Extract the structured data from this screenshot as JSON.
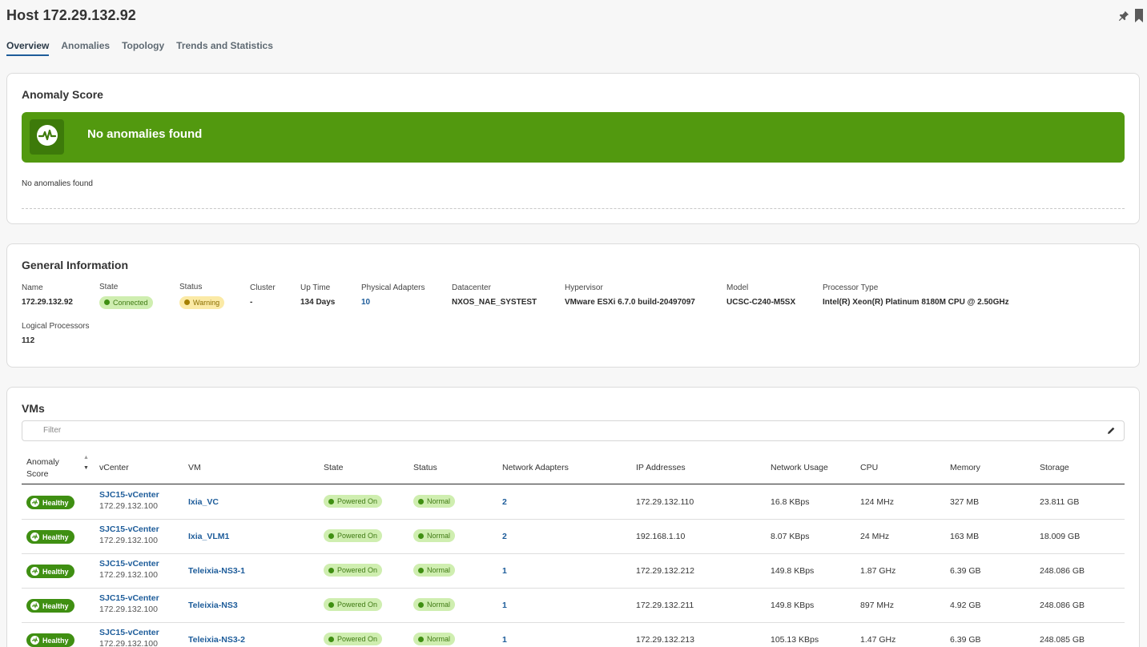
{
  "header": {
    "title": "Host 172.29.132.92"
  },
  "tabs": [
    {
      "label": "Overview",
      "active": true
    },
    {
      "label": "Anomalies"
    },
    {
      "label": "Topology"
    },
    {
      "label": "Trends and Statistics"
    }
  ],
  "anomaly": {
    "title": "Anomaly Score",
    "banner_text": "No anomalies found",
    "note": "No anomalies found",
    "color": "#52990f"
  },
  "general": {
    "title": "General Information",
    "name_label": "Name",
    "name": "172.29.132.92",
    "state_label": "State",
    "state": "Connected",
    "status_label": "Status",
    "status": "Warning",
    "cluster_label": "Cluster",
    "cluster": "-",
    "uptime_label": "Up Time",
    "uptime": "134 Days",
    "adapters_label": "Physical Adapters",
    "adapters": "10",
    "datacenter_label": "Datacenter",
    "datacenter": "NXOS_NAE_SYSTEST",
    "hypervisor_label": "Hypervisor",
    "hypervisor": "VMware ESXi 6.7.0 build-20497097",
    "model_label": "Model",
    "model": "UCSC-C240-M5SX",
    "processor_label": "Processor Type",
    "processor": "Intel(R) Xeon(R) Platinum 8180M CPU @ 2.50GHz",
    "logical_label": "Logical Processors",
    "logical": "112"
  },
  "vms": {
    "title": "VMs",
    "filter_placeholder": "Filter",
    "columns": {
      "anomaly_line1": "Anomaly",
      "anomaly_line2": "Score",
      "vcenter": "vCenter",
      "vm": "VM",
      "state": "State",
      "status": "Status",
      "adapters": "Network Adapters",
      "ip": "IP Addresses",
      "usage": "Network Usage",
      "cpu": "CPU",
      "memory": "Memory",
      "storage": "Storage"
    },
    "rows": [
      {
        "score": "Healthy",
        "vcenter": "SJC15-vCenter",
        "vcenter_ip": "172.29.132.100",
        "vm": "Ixia_VC",
        "state": "Powered On",
        "status": "Normal",
        "adapters": "2",
        "ip": "172.29.132.110",
        "usage": "16.8 KBps",
        "cpu": "124 MHz",
        "memory": "327 MB",
        "storage": "23.811 GB"
      },
      {
        "score": "Healthy",
        "vcenter": "SJC15-vCenter",
        "vcenter_ip": "172.29.132.100",
        "vm": "Ixia_VLM1",
        "state": "Powered On",
        "status": "Normal",
        "adapters": "2",
        "ip": "192.168.1.10",
        "usage": "8.07 KBps",
        "cpu": "24 MHz",
        "memory": "163 MB",
        "storage": "18.009 GB"
      },
      {
        "score": "Healthy",
        "vcenter": "SJC15-vCenter",
        "vcenter_ip": "172.29.132.100",
        "vm": "Teleixia-NS3-1",
        "state": "Powered On",
        "status": "Normal",
        "adapters": "1",
        "ip": "172.29.132.212",
        "usage": "149.8 KBps",
        "cpu": "1.87 GHz",
        "memory": "6.39 GB",
        "storage": "248.086 GB"
      },
      {
        "score": "Healthy",
        "vcenter": "SJC15-vCenter",
        "vcenter_ip": "172.29.132.100",
        "vm": "Teleixia-NS3",
        "state": "Powered On",
        "status": "Normal",
        "adapters": "1",
        "ip": "172.29.132.211",
        "usage": "149.8 KBps",
        "cpu": "897 MHz",
        "memory": "4.92 GB",
        "storage": "248.086 GB"
      },
      {
        "score": "Healthy",
        "vcenter": "SJC15-vCenter",
        "vcenter_ip": "172.29.132.100",
        "vm": "Teleixia-NS3-2",
        "state": "Powered On",
        "status": "Normal",
        "adapters": "1",
        "ip": "172.29.132.213",
        "usage": "105.13 KBps",
        "cpu": "1.47 GHz",
        "memory": "6.39 GB",
        "storage": "248.085 GB"
      }
    ]
  }
}
